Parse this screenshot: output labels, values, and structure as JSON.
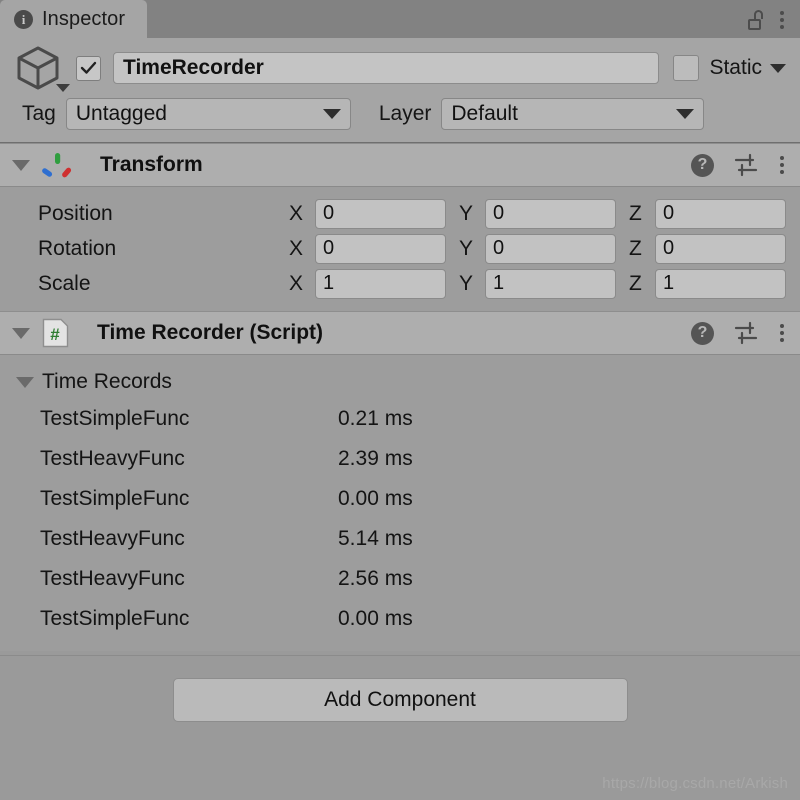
{
  "window": {
    "tab": {
      "label": "Inspector",
      "icon": "info-icon"
    },
    "lock_icon": "lock-open-icon",
    "menu_icon": "kebab-menu-icon"
  },
  "gameobject": {
    "icon": "cube-icon",
    "enabled_checkbox": "checked",
    "name": "TimeRecorder",
    "static_label": "Static",
    "static_checked": false,
    "tag_label": "Tag",
    "tag_value": "Untagged",
    "layer_label": "Layer",
    "layer_value": "Default"
  },
  "transform": {
    "title": "Transform",
    "icon": "transform-axis-icon",
    "help_icon": "help-icon",
    "preset_icon": "preset-sliders-icon",
    "menu_icon": "kebab-menu-icon",
    "rows": [
      {
        "label": "Position",
        "x": "0",
        "y": "0",
        "z": "0"
      },
      {
        "label": "Rotation",
        "x": "0",
        "y": "0",
        "z": "0"
      },
      {
        "label": "Scale",
        "x": "1",
        "y": "1",
        "z": "1"
      }
    ],
    "axes": [
      "X",
      "Y",
      "Z"
    ]
  },
  "script_component": {
    "title": "Time Recorder (Script)",
    "icon": "csharp-script-icon",
    "icon_glyph": "#",
    "help_icon": "help-icon",
    "preset_icon": "preset-sliders-icon",
    "menu_icon": "kebab-menu-icon",
    "list_title": "Time Records",
    "records": [
      {
        "name": "TestSimpleFunc",
        "value": "0.21 ms"
      },
      {
        "name": "TestHeavyFunc",
        "value": "2.39 ms"
      },
      {
        "name": "TestSimpleFunc",
        "value": "0.00 ms"
      },
      {
        "name": "TestHeavyFunc",
        "value": "5.14 ms"
      },
      {
        "name": "TestHeavyFunc",
        "value": "2.56 ms"
      },
      {
        "name": "TestSimpleFunc",
        "value": "0.00 ms"
      }
    ]
  },
  "footer": {
    "add_component_label": "Add Component",
    "watermark": "https://blog.csdn.net/Arkish"
  },
  "colors": {
    "tabbar_bg": "#828282",
    "panel_bg": "#9d9d9d",
    "header_bg": "#a5a5a5",
    "component_header_bg": "#aeaeae",
    "field_bg": "#c2c2c2",
    "axis_x": "#d03030",
    "axis_y": "#2f9e3f",
    "axis_z": "#2f6fd0",
    "script_green": "#2f7d32"
  }
}
